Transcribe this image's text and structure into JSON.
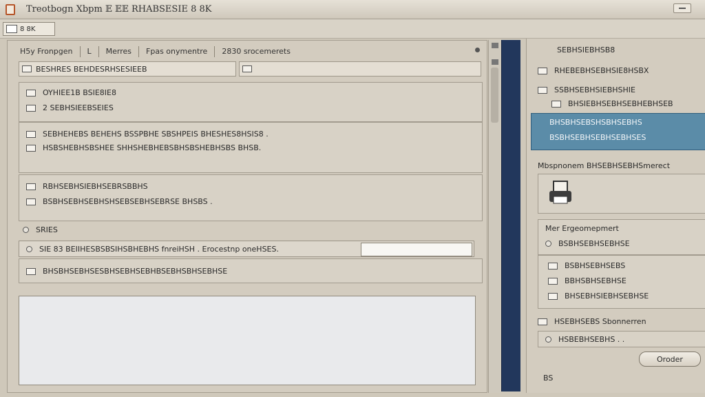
{
  "window": {
    "title": "Treotbogn Xbpm 𝔼 𝔼𝔼 RHABSESIE 8 8K"
  },
  "toolbar": {
    "button_label": "8 8K"
  },
  "tabs": [
    "H5y Fronpgen",
    "L",
    "Merres",
    "Fpas onymentre",
    "2830 srocemerets"
  ],
  "path": {
    "left": "BESHRES BEHDESRHSESIEEB",
    "right": ""
  },
  "group1": {
    "line1": "OYHIEE1B BSIE8IE8",
    "line2": "2 SEBHSIEEBSEIES"
  },
  "group2": {
    "line1": "SEBHEHEBS BEHEHS BSSPBHE SBSHPEIS BHESHES8HSIS8 .",
    "line2": "HSBSHEBHSBSHEE SHHSHEBHEBSBHSBSHEBHSBS BHSB."
  },
  "group3": {
    "line1": "RBHSEBHSIEBHSEBRSBBHS",
    "line2": "BSBHSEBHSEBHSHSEBSEBHSEBRSE BHSBS ."
  },
  "section_label": "SRIES",
  "input_row": {
    "label": "SIE 83 BEIIHESBSBSIHSBHEBHS fnreiHSH . Erocestnp oneHSES."
  },
  "checkbox_row": {
    "label": "BHSBHSEBHSESBHSEBHSEBHBSEBHSBHSEBHSE"
  },
  "right": {
    "header": "SEBHSIEBHSB8",
    "item1": "RHEBEBHSEBHSIE8HSBX",
    "item2": "SSBHSEBHSIEBHSHIE",
    "item3": "BHSIEBHSEBHSEBHEBHSEB",
    "selected1": "BHSBHSEBSHSBHSEBHS",
    "selected2": "BSBHSEBHSEBHSEBHSES",
    "divider_label": "Mbspnonem  BHSEBHSEBHSmerect",
    "group_title": "Mer Ergeomepmert",
    "group_item": "BSBHSEBHSEBHSE",
    "list1": "BSBHSEBHSEBS",
    "list2": "BBHSBHSEBHSE",
    "list3": "BHSEBHSIEBHSEBHSE",
    "section2": "HSEBHSEBS Sbonnerren",
    "section2_item": "HSBEBHSEBHS . .",
    "ok_label": "Oroder",
    "footer": "BS"
  }
}
